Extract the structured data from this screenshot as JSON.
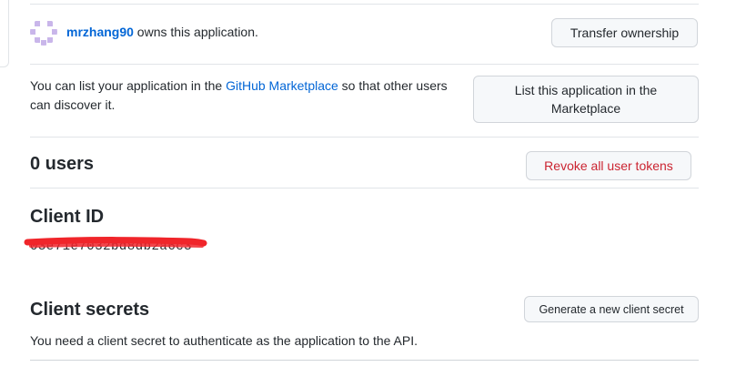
{
  "owner": {
    "username": "mrzhang90",
    "suffix": " owns this application.",
    "transfer_label": "Transfer ownership"
  },
  "marketplace": {
    "text_before": "You can list your application in the ",
    "link_text": "GitHub Marketplace",
    "text_after": " so that other users can discover it.",
    "button_label": "List this application in the Marketplace"
  },
  "users": {
    "count": "0",
    "label": " users",
    "revoke_label": "Revoke all user tokens"
  },
  "client_id": {
    "heading": "Client ID",
    "value": "03e71e7032bd8db2a6c3"
  },
  "client_secrets": {
    "heading": "Client secrets",
    "generate_label": "Generate a new client secret",
    "description": "You need a client secret to authenticate as the application to the API."
  },
  "colors": {
    "link": "#0366d6",
    "danger": "#cb2431",
    "redaction": "#f0252a",
    "avatar": "#c9b6ea"
  }
}
